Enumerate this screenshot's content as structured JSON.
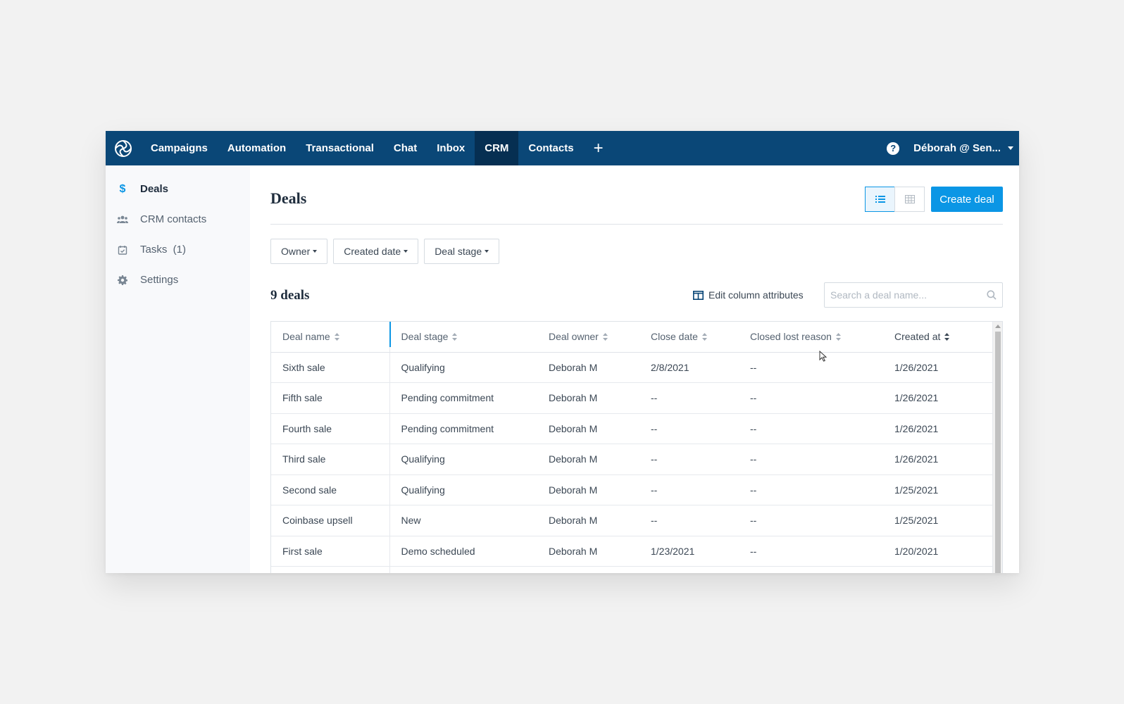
{
  "nav": {
    "items": [
      "Campaigns",
      "Automation",
      "Transactional",
      "Chat",
      "Inbox",
      "CRM",
      "Contacts"
    ],
    "active": "CRM",
    "plus": "+",
    "help": "?",
    "user": "Déborah @ Sen..."
  },
  "sidebar": {
    "items": [
      {
        "label": "Deals",
        "icon": "dollar-icon"
      },
      {
        "label": "CRM contacts",
        "icon": "users-icon"
      },
      {
        "label": "Tasks  (1)",
        "icon": "calendar-check-icon"
      },
      {
        "label": "Settings",
        "icon": "gear-icon"
      }
    ]
  },
  "main": {
    "title": "Deals",
    "create_label": "Create deal",
    "filters": [
      "Owner",
      "Created date",
      "Deal stage"
    ],
    "count": "9 deals",
    "edit_columns": "Edit column attributes",
    "search_placeholder": "Search a deal name..."
  },
  "table": {
    "columns": [
      "Deal name",
      "Deal stage",
      "Deal owner",
      "Close date",
      "Closed lost reason",
      "Created at"
    ],
    "rows": [
      [
        "Sixth sale",
        "Qualifying",
        "Deborah M",
        "2/8/2021",
        "--",
        "1/26/2021"
      ],
      [
        "Fifth sale",
        "Pending commitment",
        "Deborah M",
        "--",
        "--",
        "1/26/2021"
      ],
      [
        "Fourth sale",
        "Pending commitment",
        "Deborah M",
        "--",
        "--",
        "1/26/2021"
      ],
      [
        "Third sale",
        "Qualifying",
        "Deborah M",
        "--",
        "--",
        "1/26/2021"
      ],
      [
        "Second sale",
        "Qualifying",
        "Deborah M",
        "--",
        "--",
        "1/25/2021"
      ],
      [
        "Coinbase upsell",
        "New",
        "Deborah M",
        "--",
        "--",
        "1/25/2021"
      ],
      [
        "First sale",
        "Demo scheduled",
        "Deborah M",
        "1/23/2021",
        "--",
        "1/20/2021"
      ],
      [
        "",
        "",
        "",
        "",
        "",
        ""
      ]
    ]
  }
}
